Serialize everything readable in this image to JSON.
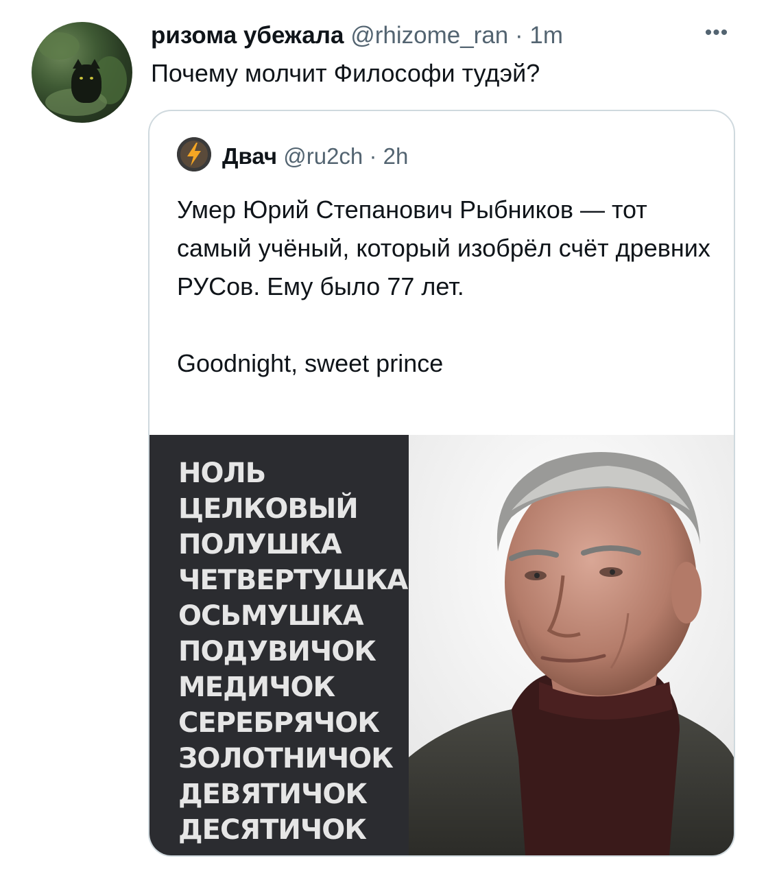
{
  "tweet": {
    "author_name": "ризома убежала",
    "author_handle": "@rhizome_ran",
    "separator": "·",
    "time": "1m",
    "more_icon": "more-horizontal-icon",
    "more_label": "•••",
    "text": "Почему молчит Философи тудэй?"
  },
  "quoted": {
    "author_name": "Двач",
    "author_handle": "@ru2ch",
    "separator": "·",
    "time": "2h",
    "paragraph1": "Умер Юрий Степанович Рыбников — тот самый учёный, который изобрёл счёт древних РУСов. Ему было 77 лет.",
    "paragraph2": "Goodnight, sweet prince",
    "image": {
      "words": [
        "НОЛЬ",
        "ЦЕЛКОВЫЙ",
        "ПОЛУШКА",
        "ЧЕТВЕРТУШКА",
        "ОСЬМУШКА",
        "ПОДУВИЧОК",
        "МЕДИЧОК",
        "СЕРЕБРЯЧОК",
        "ЗОЛОТНИЧОК",
        "ДЕВЯТИЧОК",
        "ДЕСЯТИЧОК"
      ],
      "panel_color": "#2b2c30",
      "portrait": "portrait-photo-elderly-man"
    }
  },
  "colors": {
    "text_primary": "#0f1419",
    "text_secondary": "#536471",
    "border": "#cfd9de"
  }
}
